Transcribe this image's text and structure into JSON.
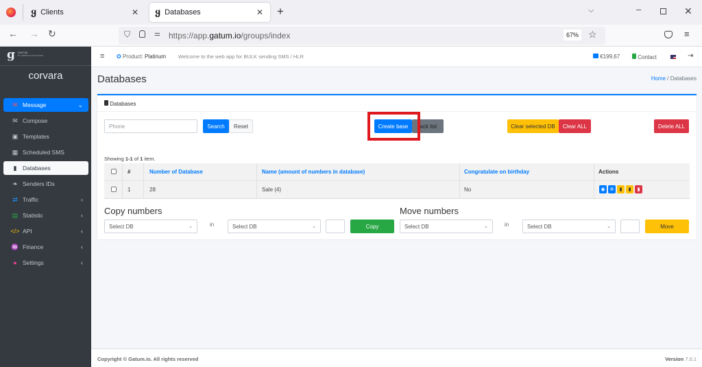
{
  "browser": {
    "tabs": [
      {
        "label": "Clients",
        "active": false
      },
      {
        "label": "Databases",
        "active": true
      }
    ],
    "url_prefix": "https://app.",
    "url_domain": "gatum.io",
    "url_path": "/groups/index",
    "zoom": "67%"
  },
  "sidebar": {
    "brand_name": "GATUM",
    "brand_sub": "BY GEMINUS SOLUTIONS",
    "user": "corvara",
    "items": [
      {
        "label": "Message",
        "icon": "message-icon",
        "expanded": true
      },
      {
        "label": "Compose",
        "icon": "envelope-icon"
      },
      {
        "label": "Templates",
        "icon": "template-icon"
      },
      {
        "label": "Scheduled SMS",
        "icon": "calendar-check-icon"
      },
      {
        "label": "Databases",
        "icon": "clipboard-icon",
        "active": true
      },
      {
        "label": "Senders IDs",
        "icon": "feather-icon"
      },
      {
        "label": "Traffic",
        "icon": "traffic-icon"
      },
      {
        "label": "Statistic",
        "icon": "chart-icon"
      },
      {
        "label": "API",
        "icon": "code-icon"
      },
      {
        "label": "Finance",
        "icon": "finance-icon"
      },
      {
        "label": "Settings",
        "icon": "user-cog-icon"
      }
    ]
  },
  "topnav": {
    "product_label": "Product:",
    "product_value": "Platinum",
    "welcome": "Welcome to the web app for BULK sending SMS / HLR",
    "balance": "€199,67",
    "contact": "Contact"
  },
  "page": {
    "title": "Databases",
    "breadcrumb_home": "Home",
    "breadcrumb_sep": "/",
    "breadcrumb_current": "Databases"
  },
  "card": {
    "title": "Databases",
    "phone_placeholder": "Phone",
    "search": "Search",
    "reset": "Reset",
    "create_base": "Create base",
    "black_list": "lack list",
    "clear_selected": "Clear selected DB",
    "clear_all": "Clear ALL",
    "delete_all": "Delete ALL",
    "summary_pre": "Showing ",
    "summary_range": "1-1",
    "summary_mid": " of ",
    "summary_total": "1",
    "summary_post": " item."
  },
  "table": {
    "headers": [
      "#",
      "Number of Database",
      "Name (amount of numbers in database)",
      "Congratulate on birthday",
      "Actions"
    ],
    "rows": [
      {
        "index": "1",
        "number": "28",
        "name": "Sale (4)",
        "birthday": "No"
      }
    ]
  },
  "copy": {
    "title": "Copy numbers",
    "from": "Select DB",
    "in": "in",
    "to": "Select DB",
    "count": "",
    "button": "Copy"
  },
  "move": {
    "title": "Move numbers",
    "from": "Select DB",
    "in": "in",
    "to": "Select DB",
    "count": "",
    "button": "Move"
  },
  "footer": {
    "copyright": "Copyright © Gatum.io. All rights reserved",
    "version_label": "Version",
    "version": "7.0.1"
  },
  "colors": {
    "primary": "#007bff",
    "warning": "#ffc107",
    "danger": "#dc3545",
    "success": "#28a745",
    "secondary": "#6c757d",
    "highlight": "#e0191f"
  }
}
